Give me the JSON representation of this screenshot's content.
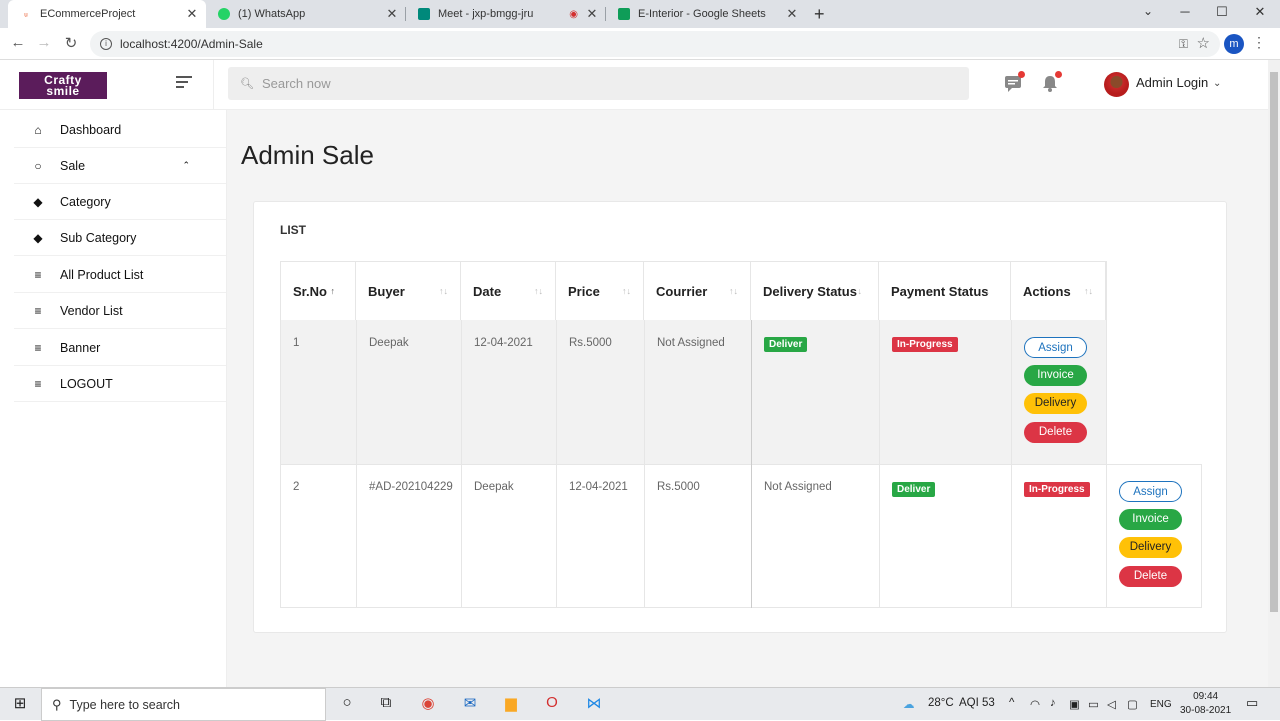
{
  "browser": {
    "tabs": [
      {
        "title": "ECommerceProject",
        "fav_color": "#e64a19"
      },
      {
        "title": "(1) WhatsApp",
        "fav_color": "#25d366"
      },
      {
        "title": "Meet - jxp-bmgg-jru",
        "fav_color": "#00897b"
      },
      {
        "title": "E-Interior - Google Sheets",
        "fav_color": "#0f9d58"
      }
    ],
    "url": "localhost:4200/Admin-Sale",
    "profile_initial": "m"
  },
  "app": {
    "logo_line1": "Crafty",
    "logo_line2": "smile",
    "search_placeholder": "Search now",
    "user_label": "Admin Login"
  },
  "sidebar": {
    "items": [
      {
        "label": "Dashboard",
        "icon": "home-icon"
      },
      {
        "label": "Sale",
        "icon": "circle-icon"
      },
      {
        "label": "Category",
        "icon": "layers-icon"
      },
      {
        "label": "Sub Category",
        "icon": "layers-icon"
      },
      {
        "label": "All Product List",
        "icon": "list-icon"
      },
      {
        "label": "Vendor List",
        "icon": "list-icon"
      },
      {
        "label": "Banner",
        "icon": "list-icon"
      },
      {
        "label": "LOGOUT",
        "icon": "list-icon"
      }
    ]
  },
  "page": {
    "title": "Admin Sale",
    "card_title": "LIST"
  },
  "table": {
    "headers": [
      "Sr.No",
      "Buyer",
      "Date",
      "Price",
      "Courrier",
      "Delivery Status",
      "Payment Status",
      "Actions"
    ],
    "row1": {
      "srno": "1",
      "buyer": "Deepak",
      "date": "12-04-2021",
      "price": "Rs.5000",
      "courrier": "Not Assigned",
      "delivery_status": "Deliver",
      "payment_status": "In-Progress"
    },
    "row2": {
      "srno": "2",
      "order_id": "#AD-202104229",
      "buyer": "Deepak",
      "date": "12-04-2021",
      "price": "Rs.5000",
      "courrier": "Not Assigned",
      "delivery_status": "Deliver",
      "payment_status": "In-Progress"
    },
    "actions": {
      "assign": "Assign",
      "invoice": "Invoice",
      "delivery": "Delivery",
      "delete": "Delete"
    }
  },
  "taskbar": {
    "search_placeholder": "Type here to search",
    "weather": "28°C",
    "aqi": "AQI 53",
    "lang": "ENG",
    "time": "09:44",
    "date": "30-08-2021"
  }
}
